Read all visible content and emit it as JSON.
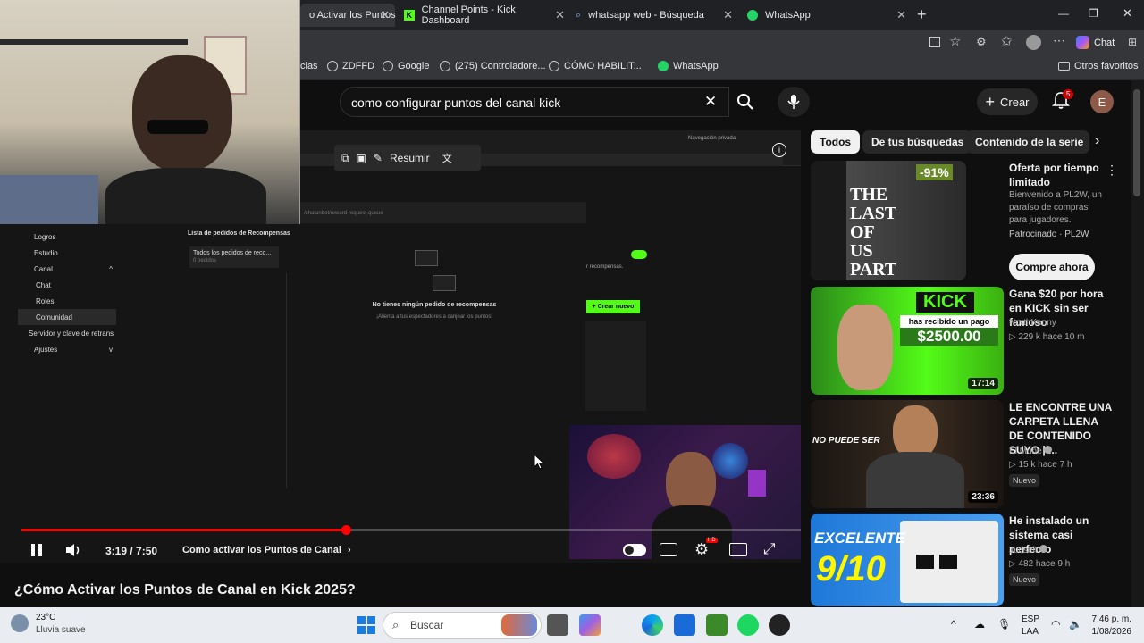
{
  "browser": {
    "tabs": [
      {
        "label": "o Activar los Puntos",
        "active": true
      },
      {
        "label": "Channel Points - Kick Dashboard"
      },
      {
        "label": "whatsapp web - Búsqueda"
      },
      {
        "label": "WhatsApp"
      }
    ],
    "chat_label": "Chat",
    "bookmarks": [
      {
        "label": "cias"
      },
      {
        "label": "ZDFFD"
      },
      {
        "label": "Google"
      },
      {
        "label": "(275) Controladore..."
      },
      {
        "label": "CÓMO HABILIT..."
      },
      {
        "label": "WhatsApp"
      }
    ],
    "other_favorites": "Otros favoritos"
  },
  "youtube": {
    "search_query": "como configurar puntos del canal kick",
    "create_label": "Crear",
    "notification_count": "5",
    "avatar_initial": "E"
  },
  "video": {
    "floating_toolbar_label": "Resumir",
    "kick_sidebar": [
      {
        "label": "Logros",
        "sub": false,
        "selected": false
      },
      {
        "label": "Estudio",
        "sub": false,
        "selected": false
      },
      {
        "label": "Canal",
        "sub": false,
        "selected": false
      },
      {
        "label": "Chat",
        "sub": true,
        "selected": false
      },
      {
        "label": "Roles",
        "sub": true,
        "selected": false
      },
      {
        "label": "Comunidad",
        "sub": true,
        "selected": true
      },
      {
        "label": "Servidor y clave de retrans",
        "sub": true,
        "selected": false
      },
      {
        "label": "Ajustes",
        "sub": false,
        "selected": false
      }
    ],
    "popup_title": "Lista de pedidos de Recompensas",
    "popup_url": "/chatanbot/reward-request-queue",
    "popup_list_item": "Todos los pedidos de reco...",
    "popup_list_sub": "0 pedidos",
    "empty_title": "No tienes ningún pedido de recompensas",
    "empty_sub": "¡Alienta a tus espectadores a canjear los puntos!",
    "bg_text": "r recompensas.",
    "create_new_label": "+ Crear nuevo",
    "inner_private_label": "Navegación privada",
    "time_current": "3:19",
    "time_total": "7:50",
    "chapter": "Como activar los Puntos de Canal",
    "progress": 0.416,
    "title": "¿Cómo Activar los Puntos de Canal en Kick 2025?"
  },
  "sidebar": {
    "chips": [
      "Todos",
      "De tus búsquedas",
      "Contenido de la serie"
    ],
    "recommendations": [
      {
        "title": "Oferta por tiempo limitado",
        "channel": "Bienvenido a PL2W, un paraíso de compras para jugadores.",
        "meta": "Patrocinado · PL2W",
        "thumb_text": "THE LAST OF US PART II PC",
        "discount": "-91%",
        "cta": "Compre ahora"
      },
      {
        "title": "Gana $20 por hora en KICK sin ser famoso",
        "channel": "NorthKenny",
        "meta": "▷ 229 k  hace 10 m",
        "duration": "17:14",
        "thumb_text": "KICK",
        "thumb_sub": "has recibido un pago",
        "thumb_amount": "$2500.00"
      },
      {
        "title": "LE ENCONTRE UNA CARPETA LLENA DE CONTENIDO SUYO | ...",
        "channel": "El Muñe",
        "meta": "▷ 15 k  hace 7 h",
        "badge": "Nuevo",
        "duration": "23:36",
        "thumb_text": "NO PUEDE SER"
      },
      {
        "title": "He instalado un sistema casi perfecto",
        "channel": "Judseit",
        "meta": "▷ 482  hace 9 h",
        "badge": "Nuevo",
        "thumb_text": "EXCELENTE",
        "thumb_score": "9/10"
      }
    ]
  },
  "taskbar": {
    "weather_temp": "23°C",
    "weather_desc": "Lluvia suave",
    "search_placeholder": "Buscar",
    "lang_top": "ESP",
    "lang_bottom": "LAA",
    "time": "7:46 p. m.",
    "date": "1/08/2026"
  },
  "colors": {
    "yt_bg": "#0f0f0f",
    "kick_green": "#53fc18",
    "yt_red": "#ff0000"
  }
}
